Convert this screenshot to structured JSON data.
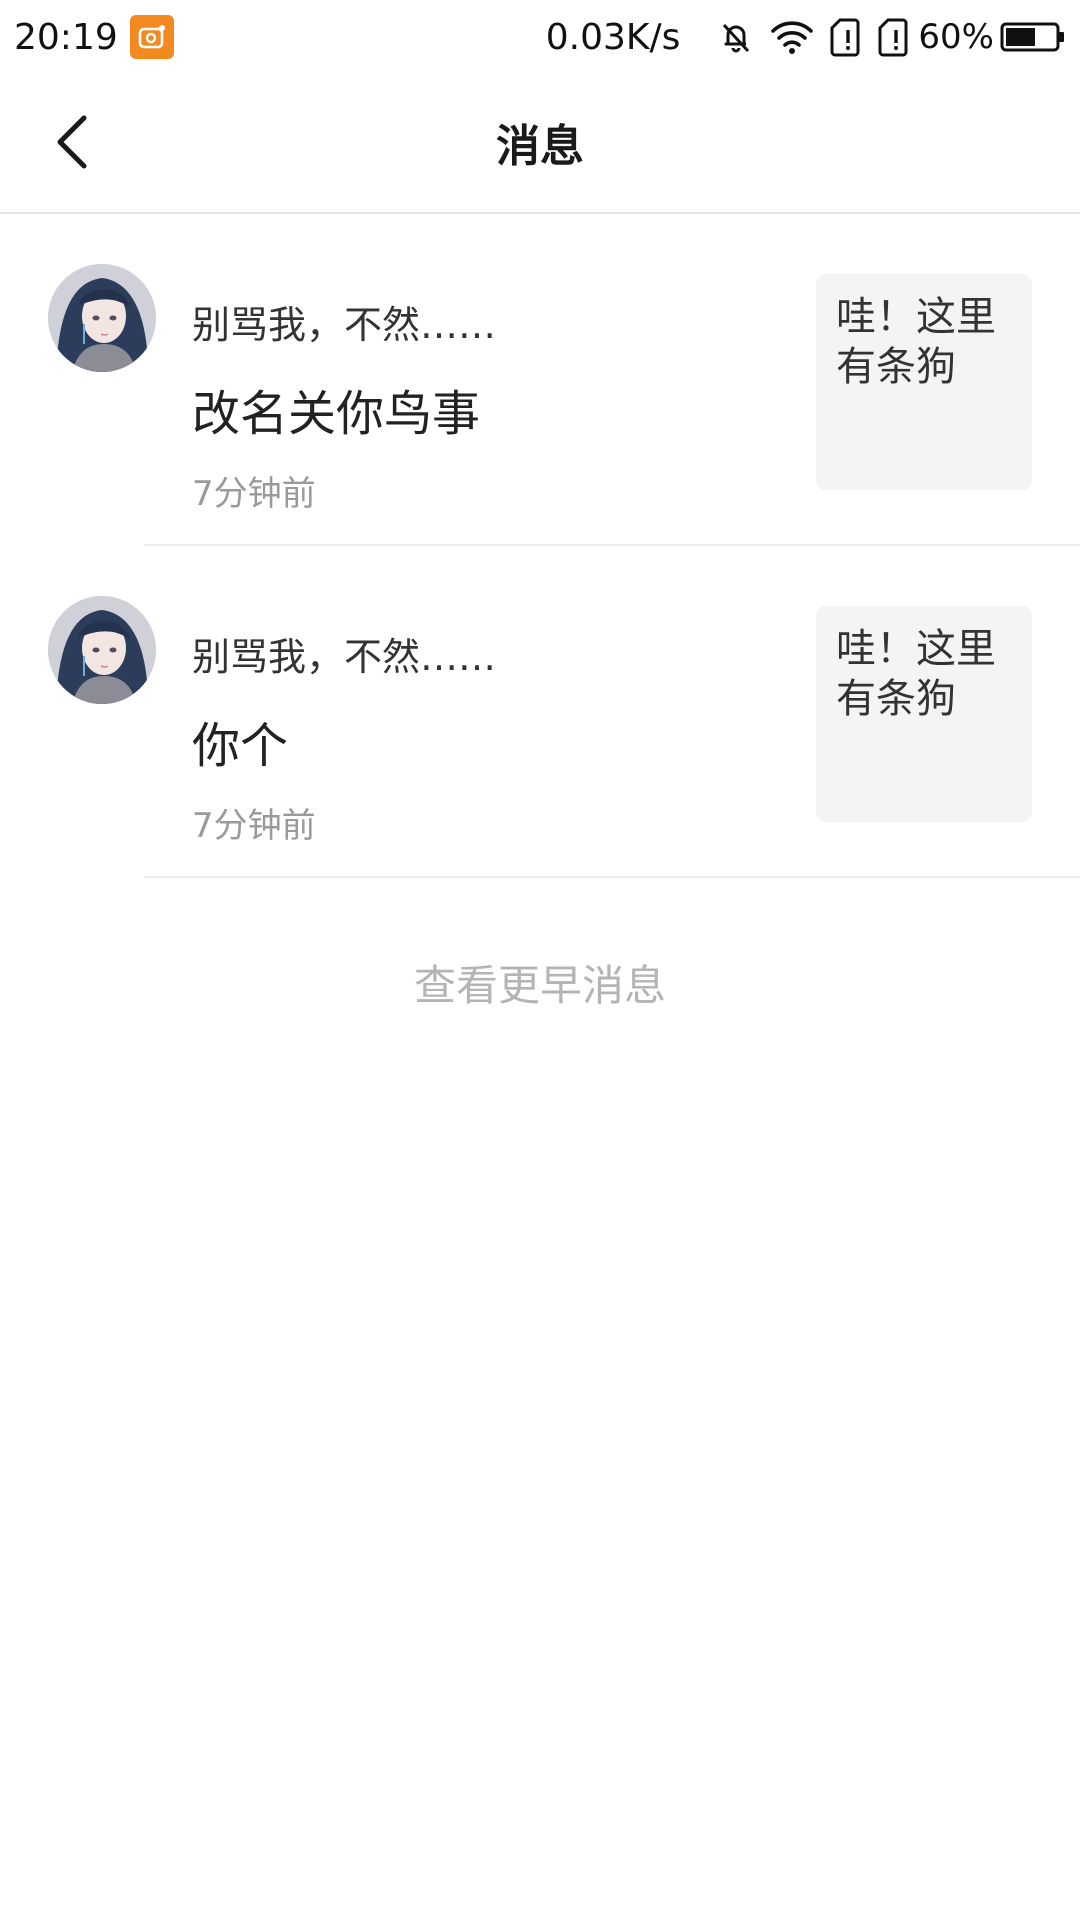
{
  "status_bar": {
    "time": "20:19",
    "network_speed": "0.03K/s",
    "battery": "60%",
    "battery_level": 0.6,
    "icons": [
      "app-notification-icon",
      "bell-muted-icon",
      "wifi-icon",
      "sim-1-icon",
      "sim-2-icon",
      "battery-icon"
    ]
  },
  "header": {
    "title": "消息",
    "back_icon": "chevron-left-icon"
  },
  "messages": [
    {
      "name": "别骂我，不然……",
      "content": "改名关你鸟事",
      "time": "7分钟前",
      "preview": "哇！这里有条狗"
    },
    {
      "name": "别骂我，不然……",
      "content": "你个",
      "time": "7分钟前",
      "preview": "哇！这里有条狗"
    }
  ],
  "more_link": "查看更早消息",
  "colors": {
    "accent_orange": "#f28a1f",
    "divider": "#ececec",
    "preview_bg": "#f4f4f4",
    "muted_text": "#9a9a9a"
  }
}
